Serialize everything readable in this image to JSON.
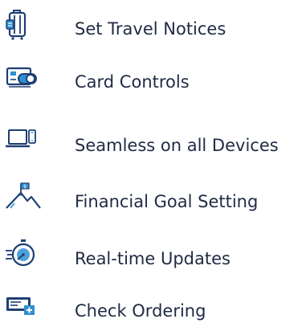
{
  "features": {
    "colors": {
      "primary": "#1f3f73",
      "accent": "#2f8fd3",
      "text": "#1f2a44"
    },
    "items": [
      {
        "icon": "luggage-icon",
        "label": "Set Travel Notices"
      },
      {
        "icon": "credit-card-toggle-icon",
        "label": "Card Controls"
      },
      {
        "icon": "devices-icon",
        "label": "Seamless on all Devices"
      },
      {
        "icon": "mountain-flag-icon",
        "label": "Financial Goal Setting"
      },
      {
        "icon": "stopwatch-icon",
        "label": "Real-time Updates"
      },
      {
        "icon": "checkbook-add-icon",
        "label": "Check Ordering"
      }
    ]
  }
}
